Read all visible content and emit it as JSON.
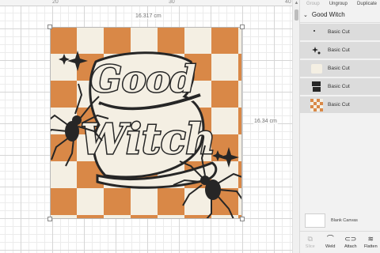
{
  "ruler": {
    "marks": [
      "20",
      "30",
      "40"
    ]
  },
  "canvas": {
    "width_label": "16.317 cm",
    "height_label": "16.34 cm"
  },
  "design": {
    "line1": "Good",
    "line2": "Witch"
  },
  "colors": {
    "orange": "#D98847",
    "cream": "#F4EFE3",
    "ink": "#262626",
    "panel": "#F2F2F2",
    "layer_bg": "#DCDCDC"
  },
  "toolbar": {
    "group": "Group",
    "ungroup": "Ungroup",
    "duplicate": "Duplicate"
  },
  "layers": {
    "group_title": "Good Witch",
    "items": [
      {
        "label": "Basic Cut",
        "icon": "small-spider-icon"
      },
      {
        "label": "Basic Cut",
        "icon": "sparkle-shape-icon"
      },
      {
        "label": "Basic Cut",
        "icon": "cream-text-icon"
      },
      {
        "label": "Basic Cut",
        "icon": "black-text-icon"
      },
      {
        "label": "Basic Cut",
        "icon": "checker-pattern-icon"
      }
    ]
  },
  "blank_canvas": {
    "label": "Blank Canvas"
  },
  "actions": [
    {
      "label": "Slice",
      "icon": "slice-icon"
    },
    {
      "label": "Weld",
      "icon": "weld-icon"
    },
    {
      "label": "Attach",
      "icon": "attach-icon"
    },
    {
      "label": "Flatten",
      "icon": "flatten-icon"
    }
  ]
}
